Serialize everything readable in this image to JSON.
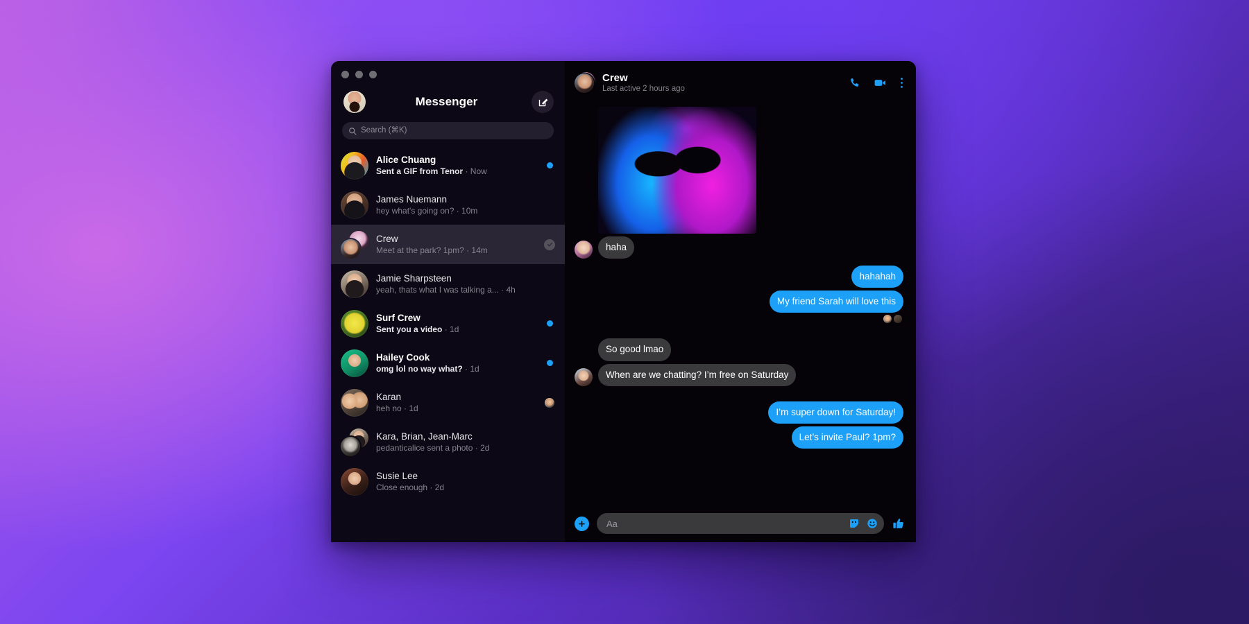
{
  "app": {
    "title": "Messenger",
    "compose_icon": "compose-pencil-icon"
  },
  "search": {
    "placeholder": "Search (⌘K)",
    "icon": "search-icon"
  },
  "conversations": [
    {
      "name": "Alice Chuang",
      "snippet": "Sent a GIF from Tenor",
      "time": "Now",
      "unread": true,
      "right": "dot",
      "avatar": "ph-alice",
      "group": false
    },
    {
      "name": "James Nuemann",
      "snippet": "hey what's going on?",
      "time": "10m",
      "unread": false,
      "right": "none",
      "avatar": "ph-james",
      "group": false
    },
    {
      "name": "Crew",
      "snippet": "Meet at the park? 1pm?",
      "time": "14m",
      "unread": false,
      "right": "check",
      "avatar": "crew",
      "group": true,
      "selected": true
    },
    {
      "name": "Jamie Sharpsteen",
      "snippet": "yeah, thats what I was talking a...",
      "time": "4h",
      "unread": false,
      "right": "none",
      "avatar": "ph-jamie",
      "group": false
    },
    {
      "name": "Surf Crew",
      "snippet": "Sent you a video",
      "time": "1d",
      "unread": true,
      "right": "dot",
      "avatar": "ph-surf",
      "group": false
    },
    {
      "name": "Hailey Cook",
      "snippet": "omg lol no way what?",
      "time": "1d",
      "unread": true,
      "right": "dot",
      "avatar": "ph-hailey",
      "group": false
    },
    {
      "name": "Karan",
      "snippet": "heh no",
      "time": "1d",
      "unread": false,
      "right": "mini",
      "avatar": "ph-karan",
      "group": false
    },
    {
      "name": "Kara, Brian, Jean-Marc",
      "snippet": "pedanticalice sent a photo",
      "time": "2d",
      "unread": false,
      "right": "none",
      "avatar": "kara",
      "group": true
    },
    {
      "name": "Susie Lee",
      "snippet": "Close enough",
      "time": "2d",
      "unread": false,
      "right": "none",
      "avatar": "ph-susie",
      "group": false
    }
  ],
  "chat": {
    "title": "Crew",
    "status": "Last active 2 hours ago",
    "icons": [
      "phone-icon",
      "video-camera-icon",
      "more-options-icon"
    ],
    "attachment": {
      "type": "gif",
      "description": "neon blue and pink cat wearing round sunglasses"
    },
    "messages": [
      {
        "side": "in",
        "text": "haha",
        "avatar": "ph-haha"
      },
      {
        "side": "out",
        "text": "hahahah"
      },
      {
        "side": "out",
        "text": "My friend Sarah will love this",
        "receipts": [
          "ph-r1",
          "ph-r2"
        ]
      },
      {
        "side": "in",
        "text": "So good lmao"
      },
      {
        "side": "in",
        "text": "When are we chatting? I’m free on Saturday",
        "avatar": "ph-sat"
      },
      {
        "side": "out",
        "text": "I’m super down for Saturday!"
      },
      {
        "side": "out",
        "text": "Let’s invite Paul? 1pm?"
      }
    ]
  },
  "composer": {
    "placeholder": "Aa",
    "add_icon": "plus-circle-icon",
    "sticker_icon": "sticker-icon",
    "emoji_icon": "emoji-smiley-icon",
    "like_icon": "thumbs-up-icon"
  },
  "colors": {
    "accent_blue": "#1da0f8",
    "bubble_in": "#3a3a3c",
    "sidebar_bg": "#0d0815",
    "chat_bg": "#050208",
    "selected_row": "#2b2635"
  }
}
